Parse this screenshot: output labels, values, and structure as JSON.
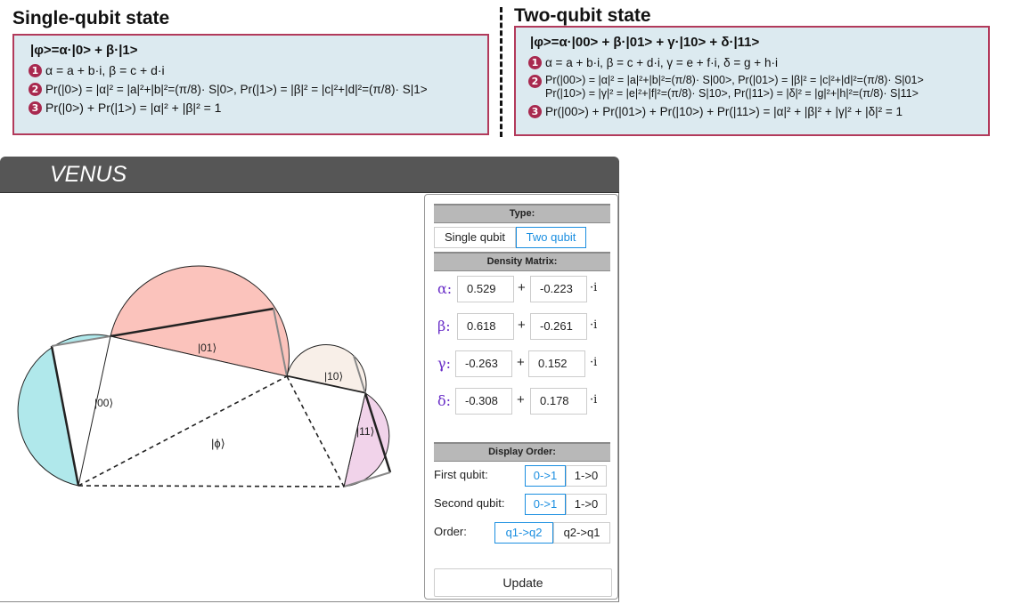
{
  "single": {
    "heading": "Single-qubit state",
    "title": "|φ>=α·|0> + β·|1>",
    "lines": [
      {
        "num": "1",
        "text": "α = a + b·i, β = c + d·i"
      },
      {
        "num": "2",
        "text": "Pr(|0>) = |α|² = |a|²+|b|²=(π/8)· S|0>, Pr(|1>) = |β|² = |c|²+|d|²=(π/8)· S|1>"
      },
      {
        "num": "3",
        "text": "Pr(|0>) + Pr(|1>) = |α|² + |β|² = 1"
      }
    ]
  },
  "two": {
    "heading": "Two-qubit state",
    "title": "|φ>=α·|00> + β·|01> + γ·|10> + δ·|11>",
    "lines": [
      {
        "num": "1",
        "text": "α = a + b·i, β = c + d·i, γ = e + f·i, δ = g + h·i"
      },
      {
        "num": "2",
        "text": "Pr(|00>) = |α|² = |a|²+|b|²=(π/8)· S|00>, Pr(|01>) = |β|² = |c|²+|d|²=(π/8)· S|01>\nPr(|10>) = |γ|² = |e|²+|f|²=(π/8)· S|10>, Pr(|11>) = |δ|² = |g|²+|h|²=(π/8)· S|11>"
      },
      {
        "num": "3",
        "text": "Pr(|00>) + Pr(|01>) + Pr(|10>) + Pr(|11>) = |α|² + |β|² + |γ|² + |δ|² = 1"
      }
    ]
  },
  "app": {
    "title": "VENUS",
    "viz_labels": {
      "k00": "|00⟩",
      "k01": "|01⟩",
      "k10": "|10⟩",
      "k11": "|11⟩",
      "phi": "|ϕ⟩"
    },
    "colors": {
      "s00": "#b0e8eb",
      "s01": "#fbc3bc",
      "s10": "#f8efe8",
      "s11": "#f1d3ea",
      "accent": "#1a8ee0",
      "greek": "#6a2fc8"
    }
  },
  "panel": {
    "type_header": "Type:",
    "type_single": "Single qubit",
    "type_two": "Two qubit",
    "density_header": "Density Matrix:",
    "amps": [
      {
        "sym": "α:",
        "re": "0.529",
        "im": "-0.223",
        "i": "·i"
      },
      {
        "sym": "β:",
        "re": "0.618",
        "im": "-0.261",
        "i": "·i"
      },
      {
        "sym": "γ:",
        "re": "-0.263",
        "im": "0.152",
        "i": "·i"
      },
      {
        "sym": "δ:",
        "re": "-0.308",
        "im": "0.178",
        "i": "·i"
      }
    ],
    "plus": "+",
    "order_header": "Display Order:",
    "first_qubit": "First qubit:",
    "second_qubit": "Second qubit:",
    "order": "Order:",
    "opt_01": "0->1",
    "opt_10": "1->0",
    "opt_q1q2": "q1->q2",
    "opt_q2q1": "q2->q1",
    "update": "Update"
  }
}
